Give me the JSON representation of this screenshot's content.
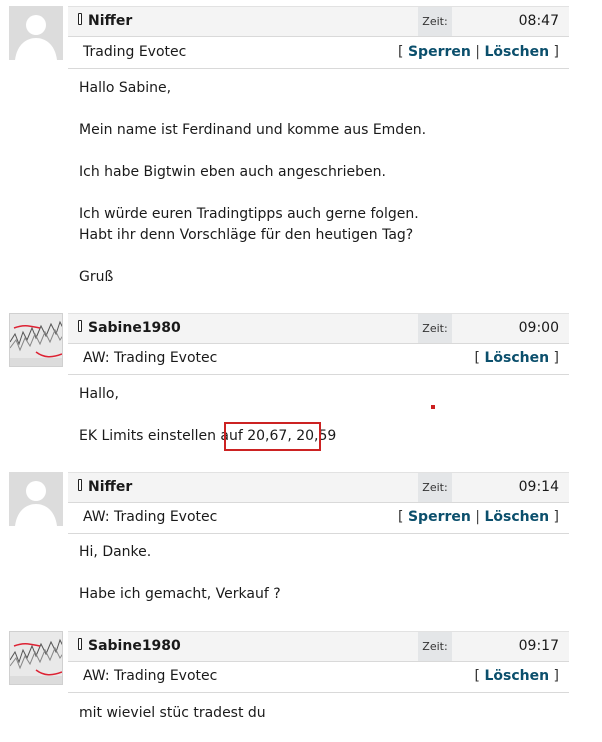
{
  "messages": [
    {
      "username": "Niffer",
      "zeit_label": "Zeit:",
      "time": "08:47",
      "subject": "Trading Evotec",
      "actions": [
        "Sperren",
        "Löschen"
      ],
      "body": [
        "Hallo Sabine,",
        "Mein name ist Ferdinand und komme aus Emden.",
        "Ich habe Bigtwin eben auch angeschrieben.",
        "Ich würde euren Tradingtipps auch gerne folgen.",
        "Habt ihr denn Vorschläge für den heutigen Tag?",
        "Gruß"
      ]
    },
    {
      "username": "Sabine1980",
      "zeit_label": "Zeit:",
      "time": "09:00",
      "subject": "AW: Trading Evotec",
      "actions": [
        "Löschen"
      ],
      "body": [
        "Hallo,",
        "EK Limits einstellen auf 20,67, 20,59"
      ]
    },
    {
      "username": "Niffer",
      "zeit_label": "Zeit:",
      "time": "09:14",
      "subject": "AW: Trading Evotec",
      "actions": [
        "Sperren",
        "Löschen"
      ],
      "body": [
        "Hi, Danke.",
        "Habe ich gemacht, Verkauf ?"
      ]
    },
    {
      "username": "Sabine1980",
      "zeit_label": "Zeit:",
      "time": "09:17",
      "subject": "AW: Trading Evotec",
      "actions": [
        "Löschen"
      ],
      "body": [
        "mit wieviel stüc tradest du"
      ]
    }
  ],
  "icons": {
    "user": "user-icon",
    "avatar_default": "default-avatar-icon",
    "avatar_chart": "chart-avatar-icon"
  },
  "colors": {
    "link": "#0b4f6c",
    "highlight": "#cc2222",
    "header_bg": "#f4f4f4"
  }
}
